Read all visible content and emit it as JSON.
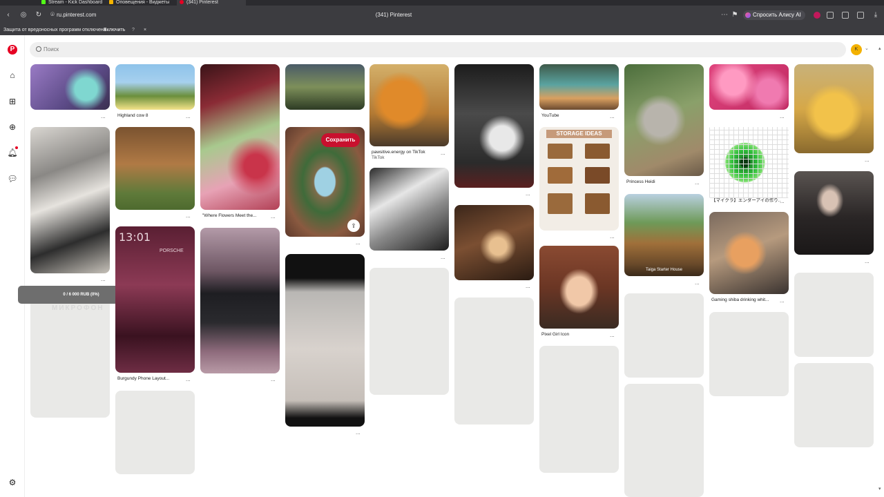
{
  "browser": {
    "tabs": [
      {
        "label": "Stream - Kick Dashboard",
        "color": "#53fc18"
      },
      {
        "label": "Оповещения - Виджеты",
        "color": "#f5b400"
      },
      {
        "label": "(341) Pinterest",
        "color": "#e60023"
      }
    ],
    "url": "ru.pinterest.com",
    "page_title": "(341) Pinterest",
    "ask_alice": "Спросить Алису AI",
    "protection_text": "Защита от вредоносных программ отключена",
    "protection_enable": "Включить",
    "protection_help": "?",
    "protection_close": "×"
  },
  "pinterest": {
    "logo": "P",
    "search_placeholder": "Поиск",
    "avatar_initial": "K",
    "save_label": "Сохранить",
    "pin_captions": {
      "highland_cow": "Highland cow 8",
      "flowers": "\"Where Flowers Meet the...",
      "burgundy": "Burgundy Phone Layout...",
      "youtube": "YouTube",
      "pawsitive": "pawsitive.energy on TikTok",
      "pawsitive_sub": "TikTok",
      "princess": "Princess Heidi",
      "pixel_girl": "Pixel Girl Icon",
      "minecraft_pattern": "【マイクラ】エンダーアイの作り...",
      "shiba": "Gaming shiba drinking whit..."
    },
    "more_dots": "...",
    "image_text": {
      "phone_time": "13:01",
      "phone_brand": "PORSCHE",
      "storage": "STORAGE IDEAS",
      "taiga": "Taiga Starter House"
    }
  },
  "stream_widget": {
    "goal": "0 / 6 000 RUB (0%)",
    "label": "МИКРОФОН"
  },
  "colors": {
    "brand": "#e60023",
    "placeholder": "#e9e9e7"
  },
  "icons": [
    "home-icon",
    "explore-icon",
    "create-icon",
    "bell-icon",
    "messages-icon",
    "settings-icon",
    "search-icon"
  ]
}
